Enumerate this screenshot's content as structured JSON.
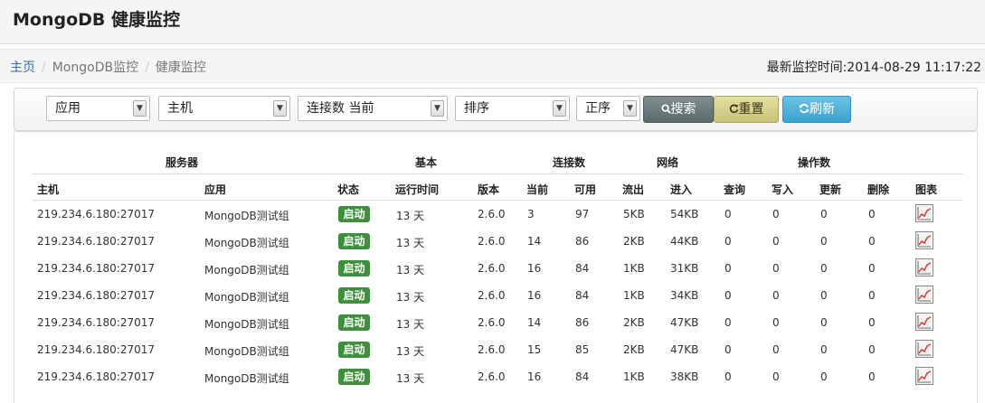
{
  "header": {
    "title": "MongoDB 健康监控"
  },
  "breadcrumb": {
    "items": [
      "主页",
      "MongoDB监控",
      "健康监控"
    ],
    "last_monitor": "最新监控时间:2014-08-29 11:17:22"
  },
  "filters": {
    "app": "应用",
    "host": "主机",
    "conn": "连接数 当前",
    "sort": "排序",
    "order": "正序",
    "search_label": "搜索",
    "reset_label": "重置",
    "refresh_label": "刷新"
  },
  "table": {
    "groups": {
      "server": "服务器",
      "basic": "基本",
      "conn": "连接数",
      "network": "网络",
      "ops": "操作数"
    },
    "columns": [
      "主机",
      "应用",
      "状态",
      "运行时间",
      "版本",
      "当前",
      "可用",
      "流出",
      "进入",
      "查询",
      "写入",
      "更新",
      "删除",
      "图表"
    ],
    "rows": [
      {
        "host": "219.234.6.180:27017",
        "app": "MongoDB测试组",
        "status": "启动",
        "uptime": "13 天",
        "version": "2.6.0",
        "current": "3",
        "available": "97",
        "out": "5KB",
        "in": "54KB",
        "query": "0",
        "insert": "0",
        "update": "0",
        "delete": "0"
      },
      {
        "host": "219.234.6.180:27017",
        "app": "MongoDB测试组",
        "status": "启动",
        "uptime": "13 天",
        "version": "2.6.0",
        "current": "14",
        "available": "86",
        "out": "2KB",
        "in": "44KB",
        "query": "0",
        "insert": "0",
        "update": "0",
        "delete": "0"
      },
      {
        "host": "219.234.6.180:27017",
        "app": "MongoDB测试组",
        "status": "启动",
        "uptime": "13 天",
        "version": "2.6.0",
        "current": "16",
        "available": "84",
        "out": "1KB",
        "in": "31KB",
        "query": "0",
        "insert": "0",
        "update": "0",
        "delete": "0"
      },
      {
        "host": "219.234.6.180:27017",
        "app": "MongoDB测试组",
        "status": "启动",
        "uptime": "13 天",
        "version": "2.6.0",
        "current": "16",
        "available": "84",
        "out": "1KB",
        "in": "34KB",
        "query": "0",
        "insert": "0",
        "update": "0",
        "delete": "0"
      },
      {
        "host": "219.234.6.180:27017",
        "app": "MongoDB测试组",
        "status": "启动",
        "uptime": "13 天",
        "version": "2.6.0",
        "current": "14",
        "available": "86",
        "out": "2KB",
        "in": "47KB",
        "query": "0",
        "insert": "0",
        "update": "0",
        "delete": "0"
      },
      {
        "host": "219.234.6.180:27017",
        "app": "MongoDB测试组",
        "status": "启动",
        "uptime": "13 天",
        "version": "2.6.0",
        "current": "15",
        "available": "85",
        "out": "2KB",
        "in": "47KB",
        "query": "0",
        "insert": "0",
        "update": "0",
        "delete": "0"
      },
      {
        "host": "219.234.6.180:27017",
        "app": "MongoDB测试组",
        "status": "启动",
        "uptime": "13 天",
        "version": "2.6.0",
        "current": "16",
        "available": "84",
        "out": "1KB",
        "in": "38KB",
        "query": "0",
        "insert": "0",
        "update": "0",
        "delete": "0"
      }
    ]
  }
}
